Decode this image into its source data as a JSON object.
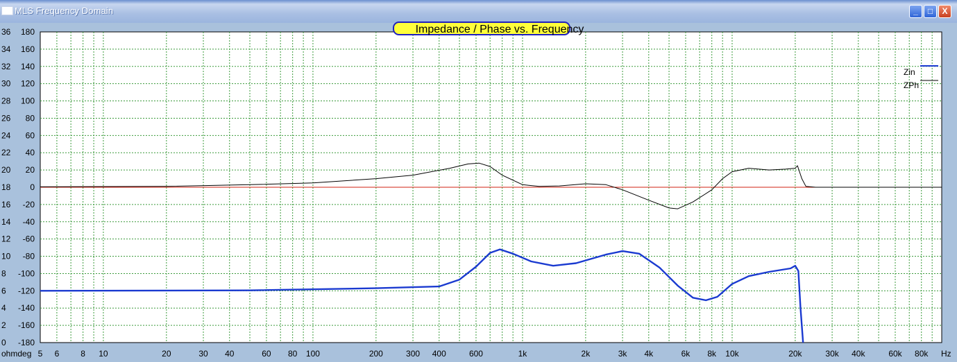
{
  "window": {
    "title": "MLS Frequency Domain",
    "minimize_glyph": "_",
    "maximize_glyph": "□",
    "close_glyph": "X"
  },
  "chart_data": {
    "type": "line",
    "title": "Impedance / Phase vs. Frequency",
    "xscale": "log",
    "xlim": [
      5,
      100000
    ],
    "y_left_unit": "ohm",
    "y_right_unit": "deg",
    "y_left_lim": [
      0,
      36
    ],
    "y_right_lim": [
      -180,
      180
    ],
    "y_left_ticks": [
      "36",
      "34",
      "32",
      "30",
      "28",
      "26",
      "24",
      "22",
      "20",
      "18",
      "16",
      "14",
      "12",
      "10",
      "8",
      "6",
      "4",
      "2",
      "0"
    ],
    "y_right_ticks": [
      "180",
      "160",
      "140",
      "120",
      "100",
      "80",
      "60",
      "40",
      "20",
      "0",
      "-20",
      "-40",
      "-60",
      "-80",
      "-100",
      "-120",
      "-140",
      "-160",
      "-180"
    ],
    "axis_corner_label": "ohmdeg",
    "x_unit_label": "Hz",
    "x_ticks": [
      {
        "v": 5,
        "label": "5"
      },
      {
        "v": 6,
        "label": "6"
      },
      {
        "v": 8,
        "label": "8"
      },
      {
        "v": 10,
        "label": "10"
      },
      {
        "v": 20,
        "label": "20"
      },
      {
        "v": 30,
        "label": "30"
      },
      {
        "v": 40,
        "label": "40"
      },
      {
        "v": 60,
        "label": "60"
      },
      {
        "v": 80,
        "label": "80"
      },
      {
        "v": 100,
        "label": "100"
      },
      {
        "v": 200,
        "label": "200"
      },
      {
        "v": 300,
        "label": "300"
      },
      {
        "v": 400,
        "label": "400"
      },
      {
        "v": 600,
        "label": "600"
      },
      {
        "v": 1000,
        "label": "1k"
      },
      {
        "v": 2000,
        "label": "2k"
      },
      {
        "v": 3000,
        "label": "3k"
      },
      {
        "v": 4000,
        "label": "4k"
      },
      {
        "v": 6000,
        "label": "6k"
      },
      {
        "v": 8000,
        "label": "8k"
      },
      {
        "v": 10000,
        "label": "10k"
      },
      {
        "v": 20000,
        "label": "20k"
      },
      {
        "v": 30000,
        "label": "30k"
      },
      {
        "v": 40000,
        "label": "40k"
      },
      {
        "v": 60000,
        "label": "60k"
      },
      {
        "v": 80000,
        "label": "80k"
      }
    ],
    "grid": true,
    "legend_position": "top-right",
    "series": [
      {
        "name": "Zin",
        "axis": "left",
        "color": "#1a3ad0",
        "points": [
          [
            5,
            6
          ],
          [
            50,
            6.05
          ],
          [
            200,
            6.3
          ],
          [
            400,
            6.5
          ],
          [
            500,
            7.3
          ],
          [
            600,
            8.8
          ],
          [
            700,
            10.4
          ],
          [
            780,
            10.8
          ],
          [
            900,
            10.3
          ],
          [
            1100,
            9.4
          ],
          [
            1400,
            8.9
          ],
          [
            1800,
            9.2
          ],
          [
            2500,
            10.2
          ],
          [
            3000,
            10.6
          ],
          [
            3600,
            10.3
          ],
          [
            4500,
            8.7
          ],
          [
            5500,
            6.6
          ],
          [
            6500,
            5.2
          ],
          [
            7500,
            4.9
          ],
          [
            8500,
            5.3
          ],
          [
            10000,
            6.8
          ],
          [
            12000,
            7.7
          ],
          [
            15000,
            8.2
          ],
          [
            19000,
            8.6
          ],
          [
            20000,
            8.9
          ],
          [
            20700,
            8.3
          ],
          [
            21200,
            4
          ],
          [
            21800,
            0
          ]
        ]
      },
      {
        "name": "ZPh",
        "axis": "right",
        "color": "#000000",
        "points": [
          [
            5,
            0.5
          ],
          [
            20,
            1
          ],
          [
            50,
            3
          ],
          [
            100,
            5
          ],
          [
            200,
            10
          ],
          [
            300,
            14
          ],
          [
            450,
            22
          ],
          [
            550,
            27
          ],
          [
            620,
            28
          ],
          [
            700,
            24
          ],
          [
            800,
            14
          ],
          [
            1000,
            3
          ],
          [
            1200,
            1
          ],
          [
            1500,
            1.5
          ],
          [
            2000,
            4
          ],
          [
            2500,
            3
          ],
          [
            3000,
            -3
          ],
          [
            4000,
            -15
          ],
          [
            5000,
            -24
          ],
          [
            5500,
            -25
          ],
          [
            6500,
            -17
          ],
          [
            8000,
            -3
          ],
          [
            9000,
            10
          ],
          [
            10000,
            18
          ],
          [
            12000,
            22
          ],
          [
            15000,
            20
          ],
          [
            18000,
            21
          ],
          [
            20000,
            22
          ],
          [
            20500,
            25
          ],
          [
            21500,
            10
          ],
          [
            22500,
            1
          ],
          [
            25000,
            0
          ],
          [
            100000,
            0
          ]
        ]
      },
      {
        "name": "",
        "axis": "right",
        "color": "#d02010",
        "points": [
          [
            5,
            0
          ],
          [
            100000,
            0
          ]
        ]
      }
    ]
  }
}
